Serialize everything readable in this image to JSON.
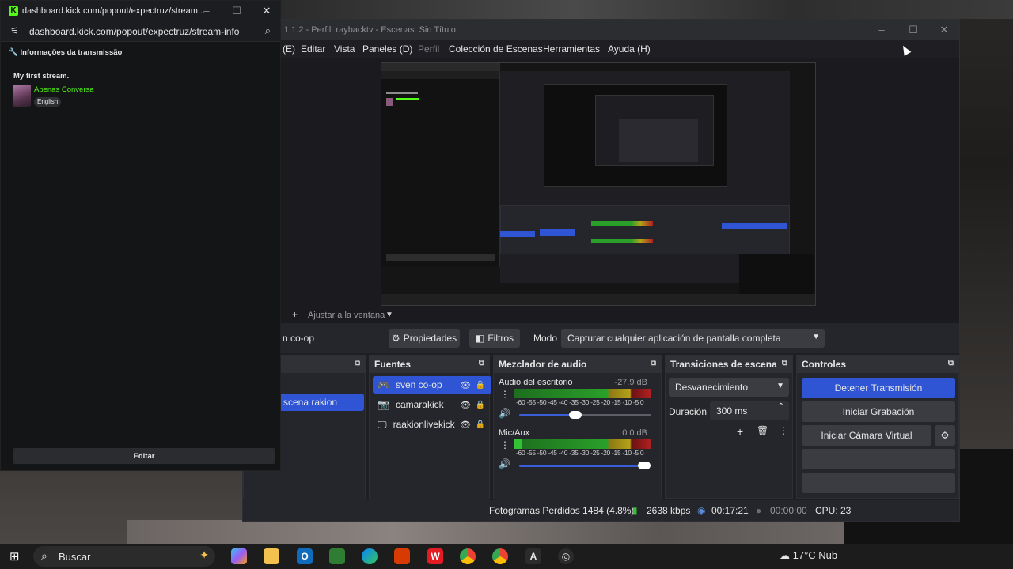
{
  "kick": {
    "tab_title": "dashboard.kick.com/popout/expectruz/stream...",
    "url": "dashboard.kick.com/popout/expectruz/stream-info",
    "section_title": "Informações da transmissão",
    "stream_title": "My first stream.",
    "category": "Apenas Conversa",
    "language_tag": "English",
    "edit_button": "Editar",
    "brand_color": "#53fc18"
  },
  "obs": {
    "window_title": "1.1.2 - Perfil: raybacktv - Escenas: Sin Título",
    "menu": {
      "partial": "(E)",
      "items": [
        "Editar",
        "Vista",
        "Paneles (D)",
        "Perfil",
        "Colección de Escenas",
        "Herramientas",
        "Ayuda (H)"
      ]
    },
    "preview_scale": "Ajustar a la ventana",
    "toolbar": {
      "scene_name": "n co-op",
      "properties": "Propiedades",
      "filters": "Filtros",
      "mode_label": "Modo",
      "mode_value": "Capturar cualquier aplicación de pantalla completa"
    },
    "scenes": {
      "selected": "scena rakion"
    },
    "sources": {
      "title": "Fuentes",
      "items": [
        {
          "name": "sven co-op",
          "icon": "gamepad-icon"
        },
        {
          "name": "camarakick",
          "icon": "camera-icon"
        },
        {
          "name": "raakionlivekick",
          "icon": "monitor-icon"
        }
      ]
    },
    "mixer": {
      "title": "Mezclador de audio",
      "scale": "-60 -55 -50 -45 -40 -35 -30 -25 -20 -15 -10 -5 0",
      "channels": [
        {
          "name": "Audio del escritorio",
          "db": "-27.9 dB",
          "volume": 0.42
        },
        {
          "name": "Mic/Aux",
          "db": "0.0 dB",
          "volume": 1.0
        }
      ]
    },
    "transitions": {
      "title": "Transiciones de escena",
      "selected": "Desvanecimiento",
      "duration_label": "Duración",
      "duration_value": "300 ms"
    },
    "controls": {
      "title": "Controles",
      "stop_stream": "Detener Transmisión",
      "start_recording": "Iniciar Grabación",
      "start_virtual_cam": "Iniciar Cámara Virtual"
    },
    "status": {
      "dropped_frames": "Fotogramas Perdidos 1484 (4.8%)",
      "bitrate": "2638 kbps",
      "stream_time": "00:17:21",
      "record_time": "00:00:00",
      "cpu": "CPU: 23"
    },
    "accent_color": "#2f55d4"
  },
  "taskbar": {
    "search_placeholder": "Buscar",
    "weather": "17°C  Nub",
    "apps": [
      "copilot-icon",
      "file-explorer-icon",
      "outlook-icon",
      "app-icon",
      "edge-icon",
      "office-icon",
      "wps-icon",
      "chrome-icon",
      "chrome-profile-icon",
      "notion-icon",
      "obs-icon"
    ]
  }
}
